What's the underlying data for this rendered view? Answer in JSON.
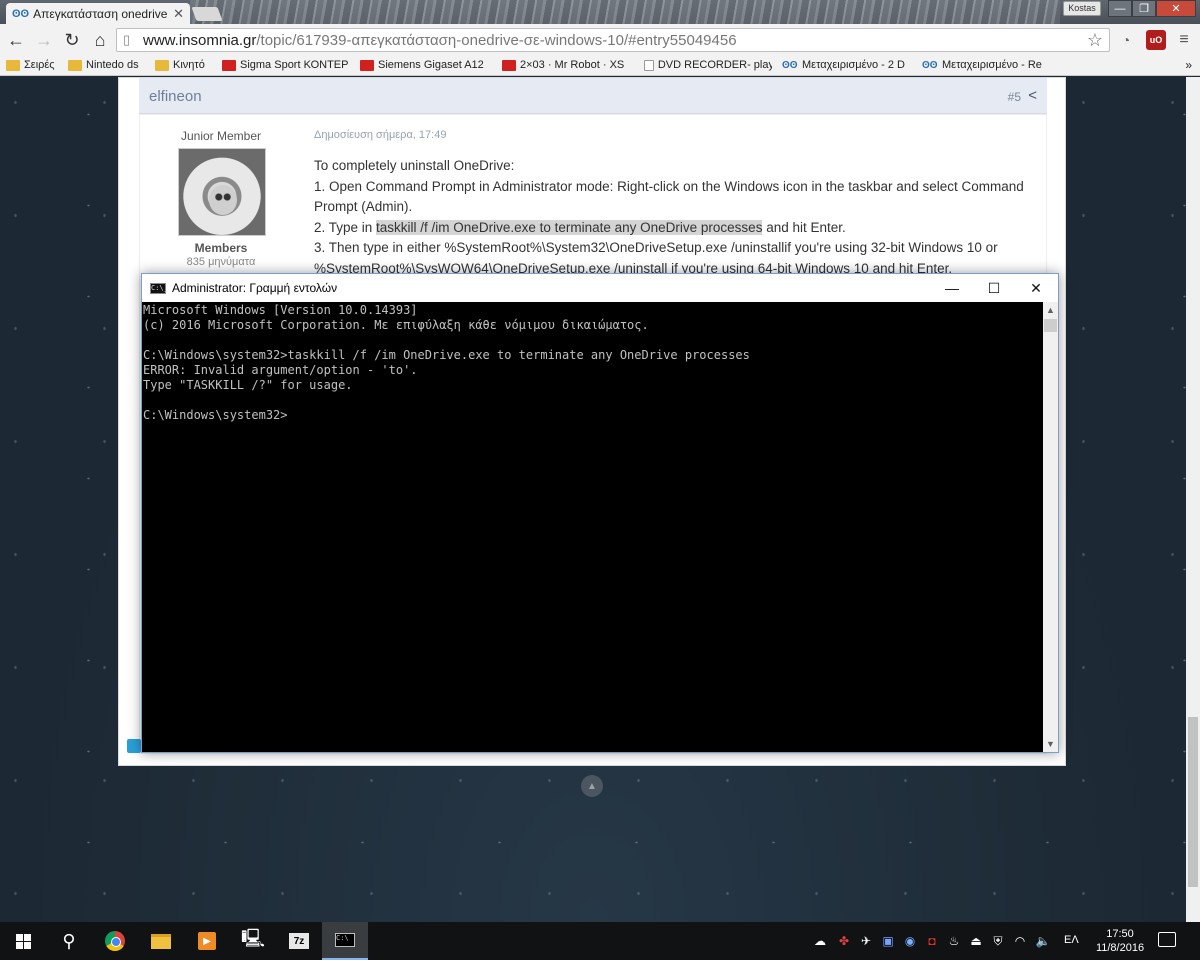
{
  "browser": {
    "tab": {
      "title": "Απεγκατάσταση onedrive",
      "favicon": "insomnia-icon"
    },
    "profile_name": "Kostas",
    "omnibox": {
      "host": "www.insomnia.gr",
      "path": "/topic/617939-απεγκατάσταση-onedrive-σε-windows-10/#entry55049456"
    },
    "bookmarks": [
      {
        "label": "Σειρές",
        "icon": "folder"
      },
      {
        "label": "Nintedo ds",
        "icon": "folder"
      },
      {
        "label": "Κινητό",
        "icon": "folder"
      },
      {
        "label": "Sigma Sport ΚΟΝΤΕΡ",
        "icon": "red"
      },
      {
        "label": "Siemens Gigaset A12",
        "icon": "red"
      },
      {
        "label": "2×03 · Mr Robot · XS",
        "icon": "red"
      },
      {
        "label": "DVD RECORDER- play",
        "icon": "doc"
      },
      {
        "label": "Μεταχειρισμένο - 2 D",
        "icon": "ins"
      },
      {
        "label": "Μεταχειρισμένο - Re",
        "icon": "ins"
      }
    ],
    "bookmarks_more": "»"
  },
  "post": {
    "author": "elfineon",
    "number": "#5",
    "rank": "Junior Member",
    "group": "Members",
    "post_count": "835 μηνύματα",
    "date": "Δημοσίευση σήμερα, 17:49",
    "lines": {
      "intro": "To completely uninstall OneDrive:",
      "step1": "1. Open Command Prompt in Administrator mode: Right-click on the Windows icon in the taskbar and select Command Prompt (Admin).",
      "step2_prefix": "2. Type in ",
      "step2_highlight": "taskkill /f /im OneDrive.exe to terminate any OneDrive processes",
      "step2_suffix": " and hit Enter.",
      "step3": "3. Then type in either %SystemRoot%\\System32\\OneDriveSetup.exe /uninstallif you're using 32-bit Windows 10 or %SystemRoot%\\SysWOW64\\OneDriveSetup.exe /uninstall if you're using 64-bit Windows 10 and hit Enter."
    }
  },
  "cmd": {
    "title": "Administrator: Γραμμή εντολών",
    "console": "Microsoft Windows [Version 10.0.14393]\n(c) 2016 Microsoft Corporation. Με επιφύλαξη κάθε νόμιμου δικαιώματος.\n\nC:\\Windows\\system32>taskkill /f /im OneDrive.exe to terminate any OneDrive processes\nERROR: Invalid argument/option - 'to'.\nType \"TASKKILL /?\" for usage.\n\nC:\\Windows\\system32>"
  },
  "taskbar": {
    "language": "ΕΛ",
    "time": "17:50",
    "date": "11/8/2016"
  },
  "colors": {
    "highlight": "#d4d4d4",
    "post_header": "#e6eaf2",
    "console_bg": "#000000",
    "console_fg": "#c0c0c0",
    "taskbar": "#101214"
  }
}
